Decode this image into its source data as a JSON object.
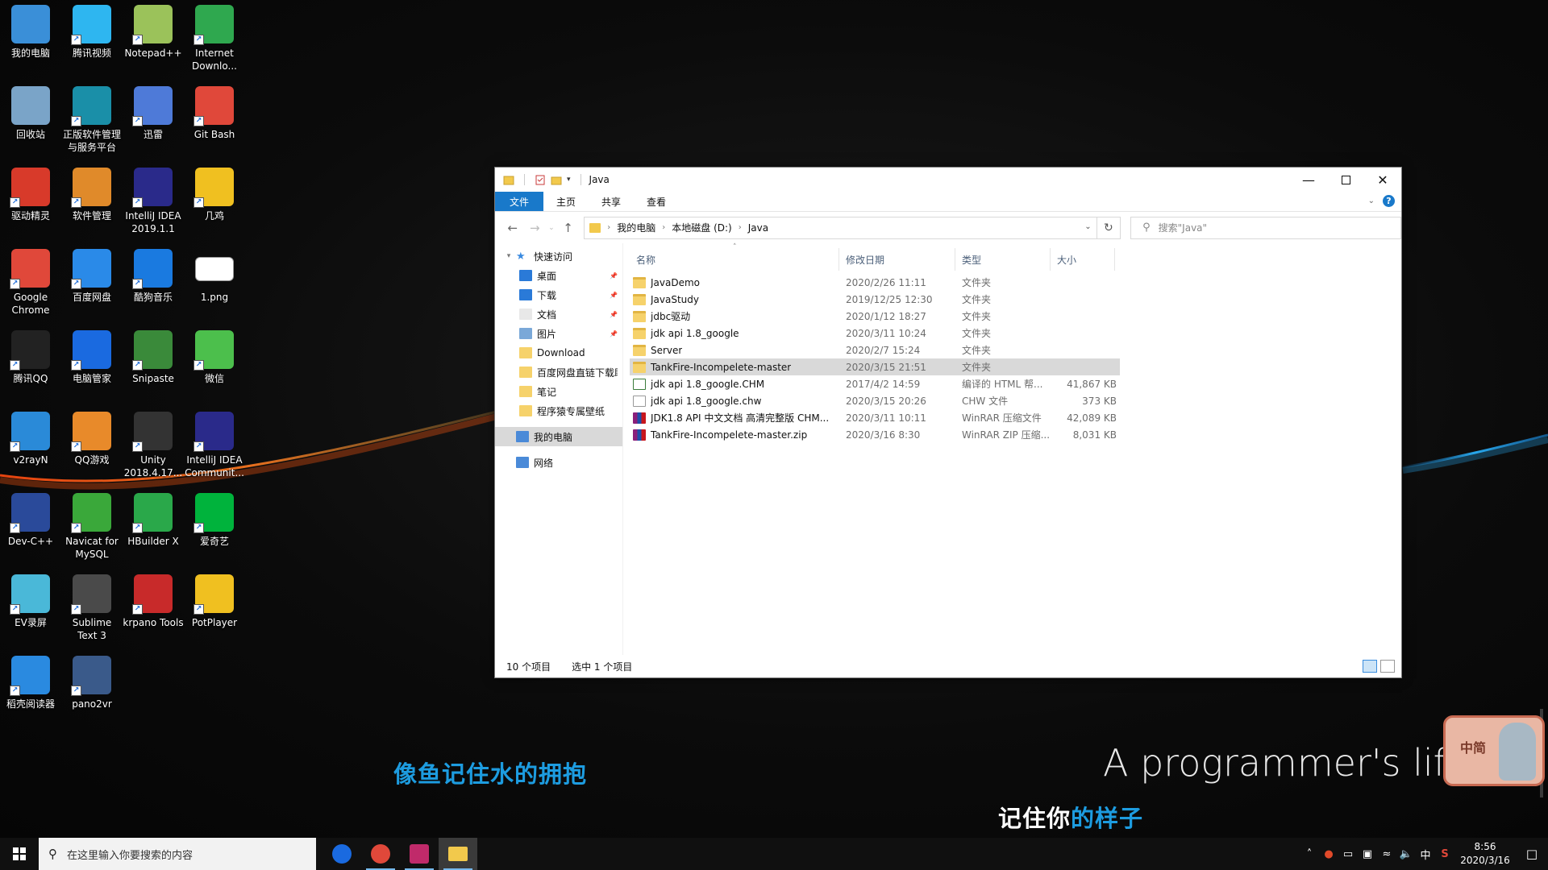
{
  "desktop": {
    "icons": [
      {
        "label": "我的电脑",
        "icon": "computer-icon",
        "color": "#3a8fd8"
      },
      {
        "label": "腾讯视频",
        "icon": "tencent-video-icon",
        "color": "#2eb6f0"
      },
      {
        "label": "Notepad++",
        "icon": "notepad-plus-plus-icon",
        "color": "#9bc25a"
      },
      {
        "label": "Internet Downlo...",
        "icon": "internet-download-manager-icon",
        "color": "#2fa84f"
      },
      {
        "label": "回收站",
        "icon": "recycle-bin-icon",
        "color": "#7aa4c8"
      },
      {
        "label": "正版软件管理与服务平台",
        "icon": "software-platform-icon",
        "color": "#1a8fa8"
      },
      {
        "label": "迅雷",
        "icon": "xunlei-icon",
        "color": "#4e7ad8"
      },
      {
        "label": "Git Bash",
        "icon": "git-bash-icon",
        "color": "#e0483a"
      },
      {
        "label": "驱动精灵",
        "icon": "driver-genius-icon",
        "color": "#d83a2a"
      },
      {
        "label": "软件管理",
        "icon": "software-manager-icon",
        "color": "#e08a2a"
      },
      {
        "label": "IntelliJ IDEA 2019.1.1",
        "icon": "intellij-idea-icon",
        "color": "#2a2a8a"
      },
      {
        "label": "几鸡",
        "icon": "jiji-icon",
        "color": "#f0c020"
      },
      {
        "label": "Google Chrome",
        "icon": "chrome-icon",
        "color": "#e0483a"
      },
      {
        "label": "百度网盘",
        "icon": "baidu-netdisk-icon",
        "color": "#2a8ae8"
      },
      {
        "label": "酷狗音乐",
        "icon": "kugou-icon",
        "color": "#1a7ae0"
      },
      {
        "label": "1.png",
        "icon": "png-file-icon",
        "color": "#ffffff"
      },
      {
        "label": "腾讯QQ",
        "icon": "qq-icon",
        "color": "#222222"
      },
      {
        "label": "电脑管家",
        "icon": "pc-manager-icon",
        "color": "#1a6ae0"
      },
      {
        "label": "Snipaste",
        "icon": "snipaste-icon",
        "color": "#3a8a3a"
      },
      {
        "label": "微信",
        "icon": "wechat-icon",
        "color": "#4cbf4c"
      },
      {
        "label": "v2rayN",
        "icon": "v2rayn-icon",
        "color": "#2a8ad8"
      },
      {
        "label": "QQ游戏",
        "icon": "qq-game-icon",
        "color": "#e88a2a"
      },
      {
        "label": "Unity 2018.4.17...",
        "icon": "unity-icon",
        "color": "#333333"
      },
      {
        "label": "IntelliJ IDEA Communit...",
        "icon": "intellij-idea-community-icon",
        "color": "#2a2a8a"
      },
      {
        "label": "Dev-C++",
        "icon": "dev-cpp-icon",
        "color": "#2a4a9a"
      },
      {
        "label": "Navicat for MySQL",
        "icon": "navicat-icon",
        "color": "#3aa83a"
      },
      {
        "label": "HBuilder X",
        "icon": "hbuilder-icon",
        "color": "#2aa84a"
      },
      {
        "label": "爱奇艺",
        "icon": "iqiyi-icon",
        "color": "#00b33c"
      },
      {
        "label": "EV录屏",
        "icon": "ev-recorder-icon",
        "color": "#4ab8d8"
      },
      {
        "label": "Sublime Text 3",
        "icon": "sublime-text-icon",
        "color": "#4a4a4a"
      },
      {
        "label": "krpano Tools",
        "icon": "krpano-icon",
        "color": "#c82a2a"
      },
      {
        "label": "PotPlayer",
        "icon": "potplayer-icon",
        "color": "#f0c020"
      },
      {
        "label": "稻壳阅读器",
        "icon": "docer-reader-icon",
        "color": "#2a8ae0"
      },
      {
        "label": "pano2vr",
        "icon": "pano2vr-icon",
        "color": "#3a5a8a"
      }
    ]
  },
  "wallpaper": {
    "lyric1": "像鱼记住水的拥抱",
    "lyric2_a": "记住你",
    "lyric2_b": "的样子",
    "tagline": "A programmer's life.",
    "sticker": "中简"
  },
  "explorer": {
    "title": "Java",
    "tabs": [
      "文件",
      "主页",
      "共享",
      "查看"
    ],
    "breadcrumb": [
      "我的电脑",
      "本地磁盘 (D:)",
      "Java"
    ],
    "search_placeholder": "搜索\"Java\"",
    "nav": [
      {
        "label": "快速访问",
        "kind": "header",
        "icon": "star-icon"
      },
      {
        "label": "桌面",
        "pinned": true,
        "icon": "desktop-folder-icon"
      },
      {
        "label": "下载",
        "pinned": true,
        "icon": "download-folder-icon"
      },
      {
        "label": "文档",
        "pinned": true,
        "icon": "documents-folder-icon"
      },
      {
        "label": "图片",
        "pinned": true,
        "icon": "pictures-folder-icon"
      },
      {
        "label": "Download",
        "pinned": false,
        "icon": "folder-icon"
      },
      {
        "label": "百度网盘直链下载助",
        "pinned": false,
        "icon": "folder-icon"
      },
      {
        "label": "笔记",
        "pinned": false,
        "icon": "folder-icon"
      },
      {
        "label": "程序猿专属壁纸",
        "pinned": false,
        "icon": "folder-icon"
      },
      {
        "label": "我的电脑",
        "kind": "header",
        "selected": true,
        "icon": "computer-icon"
      },
      {
        "label": "网络",
        "kind": "header",
        "icon": "network-icon"
      }
    ],
    "columns": {
      "name": "名称",
      "date": "修改日期",
      "type": "类型",
      "size": "大小"
    },
    "files": [
      {
        "name": "JavaDemo",
        "date": "2020/2/26 11:11",
        "type": "文件夹",
        "size": "",
        "kind": "folder"
      },
      {
        "name": "JavaStudy",
        "date": "2019/12/25 12:30",
        "type": "文件夹",
        "size": "",
        "kind": "folder"
      },
      {
        "name": "jdbc驱动",
        "date": "2020/1/12 18:27",
        "type": "文件夹",
        "size": "",
        "kind": "folder"
      },
      {
        "name": "jdk api 1.8_google",
        "date": "2020/3/11 10:24",
        "type": "文件夹",
        "size": "",
        "kind": "folder"
      },
      {
        "name": "Server",
        "date": "2020/2/7 15:24",
        "type": "文件夹",
        "size": "",
        "kind": "folder"
      },
      {
        "name": "TankFire-Incompelete-master",
        "date": "2020/3/15 21:51",
        "type": "文件夹",
        "size": "",
        "kind": "folder",
        "selected": true
      },
      {
        "name": "jdk api 1.8_google.CHM",
        "date": "2017/4/2 14:59",
        "type": "编译的 HTML 帮...",
        "size": "41,867 KB",
        "kind": "chm"
      },
      {
        "name": "jdk api 1.8_google.chw",
        "date": "2020/3/15 20:26",
        "type": "CHW 文件",
        "size": "373 KB",
        "kind": "chw"
      },
      {
        "name": "JDK1.8 API 中文文档 高清完整版 CHM...",
        "date": "2020/3/11 10:11",
        "type": "WinRAR 压缩文件",
        "size": "42,089 KB",
        "kind": "rar"
      },
      {
        "name": "TankFire-Incompelete-master.zip",
        "date": "2020/3/16 8:30",
        "type": "WinRAR ZIP 压缩...",
        "size": "8,031 KB",
        "kind": "rar"
      }
    ],
    "status_count": "10 个项目",
    "status_selected": "选中 1 个项目"
  },
  "taskbar": {
    "search_placeholder": "在这里输入你要搜索的内容",
    "apps": [
      {
        "name": "pc-manager",
        "color": "#1a6ae0"
      },
      {
        "name": "chrome",
        "color": "#e0483a"
      },
      {
        "name": "intellij-idea",
        "color": "#c02a6a"
      },
      {
        "name": "file-explorer",
        "color": "#f2c94c",
        "active": true
      }
    ],
    "ime": "中",
    "time": "8:56",
    "date": "2020/3/16"
  }
}
